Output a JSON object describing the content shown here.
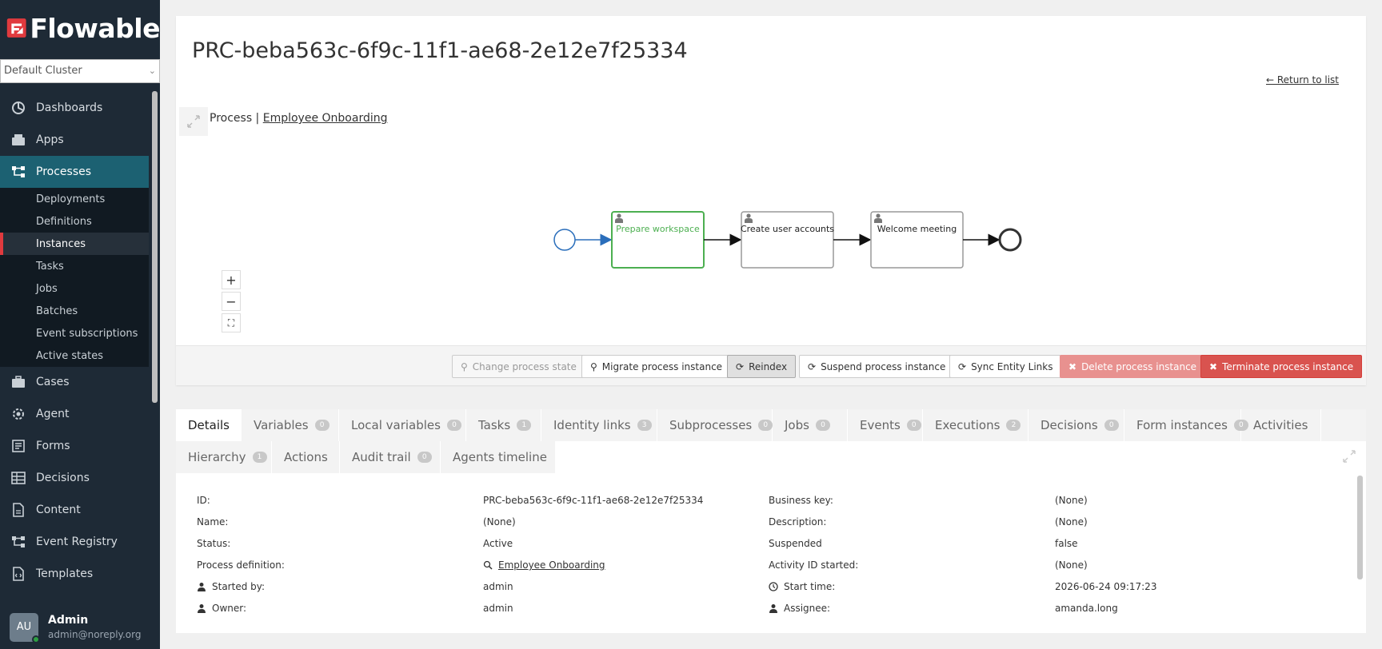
{
  "brand": {
    "name": "Flowable"
  },
  "cluster": {
    "value": "Default Cluster"
  },
  "nav": {
    "items": [
      {
        "label": "Dashboards",
        "icon": "dashboard-icon"
      },
      {
        "label": "Apps",
        "icon": "apps-icon"
      },
      {
        "label": "Processes",
        "icon": "processes-icon"
      },
      {
        "label": "Cases",
        "icon": "briefcase-icon"
      },
      {
        "label": "Agent",
        "icon": "agent-icon"
      },
      {
        "label": "Forms",
        "icon": "forms-icon"
      },
      {
        "label": "Decisions",
        "icon": "table-icon"
      },
      {
        "label": "Content",
        "icon": "content-icon"
      },
      {
        "label": "Event Registry",
        "icon": "event-registry-icon"
      },
      {
        "label": "Templates",
        "icon": "templates-icon"
      }
    ],
    "sub_items": [
      "Deployments",
      "Definitions",
      "Instances",
      "Tasks",
      "Jobs",
      "Batches",
      "Event subscriptions",
      "Active states"
    ]
  },
  "user": {
    "initials": "AU",
    "name": "Admin",
    "email": "admin@noreply.org"
  },
  "page": {
    "title": "PRC-beba563c-6f9c-11f1-ae68-2e12e7f25334",
    "return_link": "← Return to list",
    "breadcrumb_prefix": "Process | ",
    "breadcrumb_link": "Employee Onboarding"
  },
  "diagram": {
    "tasks": [
      "Prepare workspace",
      "Create user accounts",
      "Welcome meeting"
    ],
    "active_color": "#4caf50",
    "flow_color": "#2a6ebb"
  },
  "zoom": {
    "in": "+",
    "out": "−",
    "fit": "⛶"
  },
  "toolbar": {
    "change_state": "Change process state",
    "migrate": "Migrate process instance",
    "reindex": "Reindex",
    "suspend": "Suspend process instance",
    "sync": "Sync Entity Links",
    "delete": "Delete process instance",
    "terminate": "Terminate process instance"
  },
  "tabs": [
    {
      "label": "Details",
      "count": null
    },
    {
      "label": "Variables",
      "count": "0"
    },
    {
      "label": "Local variables",
      "count": "0"
    },
    {
      "label": "Tasks",
      "count": "1"
    },
    {
      "label": "Identity links",
      "count": "3"
    },
    {
      "label": "Subprocesses",
      "count": "0"
    },
    {
      "label": "Jobs",
      "count": "0"
    },
    {
      "label": "Events",
      "count": "0"
    },
    {
      "label": "Executions",
      "count": "2"
    },
    {
      "label": "Decisions",
      "count": "0"
    },
    {
      "label": "Form instances",
      "count": "0"
    },
    {
      "label": "Activities",
      "count": null
    },
    {
      "label": "Hierarchy",
      "count": "1"
    },
    {
      "label": "Actions",
      "count": null
    },
    {
      "label": "Audit trail",
      "count": "0"
    },
    {
      "label": "Agents timeline",
      "count": null
    }
  ],
  "details": {
    "left": [
      {
        "label": "ID:",
        "value": "PRC-beba563c-6f9c-11f1-ae68-2e12e7f25334"
      },
      {
        "label": "Name:",
        "value": "(None)"
      },
      {
        "label": "Status:",
        "value": "Active"
      },
      {
        "label": "Process definition:",
        "value": "Employee Onboarding"
      },
      {
        "label": "Started by:",
        "value": "admin"
      },
      {
        "label": "Owner:",
        "value": "admin"
      }
    ],
    "right": [
      {
        "label": "Business key:",
        "value": "(None)"
      },
      {
        "label": "Description:",
        "value": "(None)"
      },
      {
        "label": "Suspended",
        "value": "false"
      },
      {
        "label": "Activity ID started:",
        "value": "(None)"
      },
      {
        "label": "Start time:",
        "value": "2026-06-24 09:17:23"
      },
      {
        "label": "Assignee:",
        "value": "amanda.long"
      }
    ]
  }
}
